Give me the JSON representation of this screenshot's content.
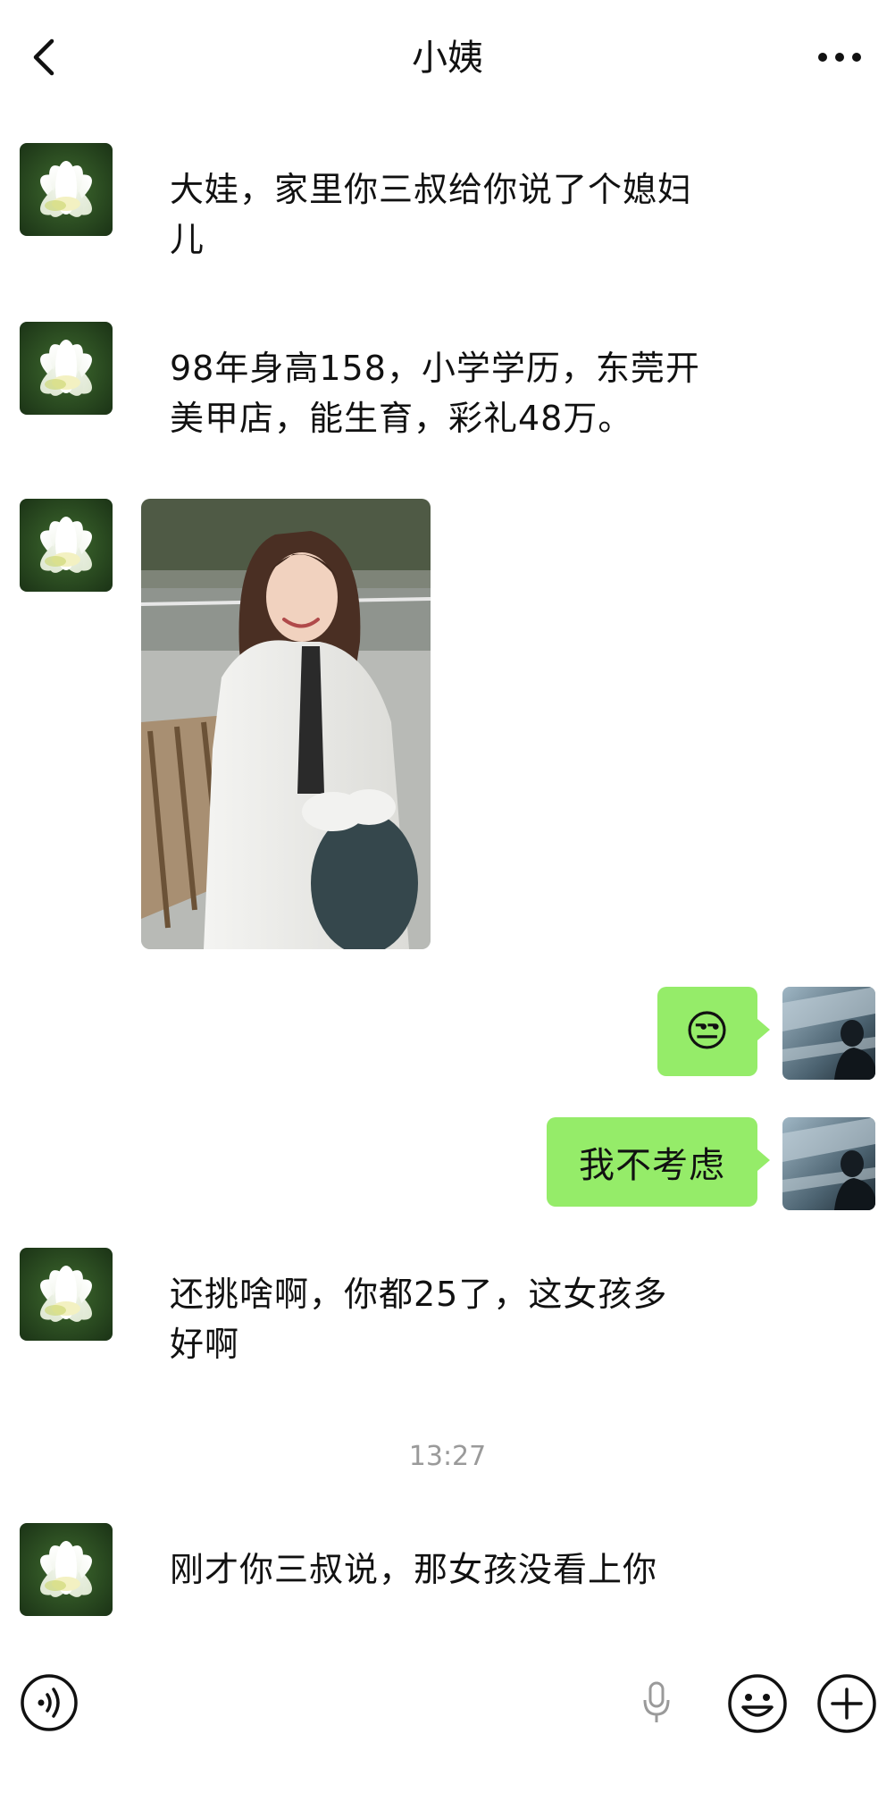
{
  "header": {
    "title": "小姨",
    "back_icon": "chevron-left-icon",
    "more_icon": "more-dots-icon"
  },
  "messages": [
    {
      "sender": "contact",
      "type": "text",
      "lines": [
        "大娃，家里你三叔给你说了个媳妇",
        "儿"
      ]
    },
    {
      "sender": "contact",
      "type": "text",
      "lines": [
        "98年身高158，小学学历，东莞开",
        "美甲店，能生育，彩礼48万。"
      ]
    },
    {
      "sender": "contact",
      "type": "image"
    },
    {
      "sender": "me",
      "type": "emoji",
      "emoji": "😒"
    },
    {
      "sender": "me",
      "type": "text",
      "text": "我不考虑"
    },
    {
      "sender": "contact",
      "type": "text",
      "lines": [
        "还挑啥啊，你都25了，这女孩多",
        "好啊"
      ]
    },
    {
      "sender": "contact",
      "type": "text",
      "lines": [
        "刚才你三叔说，那女孩没看上你"
      ]
    }
  ],
  "timestamp": "13:27",
  "toolbar": {
    "voice_icon": "voice-icon",
    "mic_icon": "microphone-icon",
    "emoji_icon": "emoji-icon",
    "plus_icon": "plus-icon"
  },
  "colors": {
    "bubble_me": "#95ec69",
    "timestamp_text": "#9a9a9a",
    "background": "#ffffff"
  }
}
